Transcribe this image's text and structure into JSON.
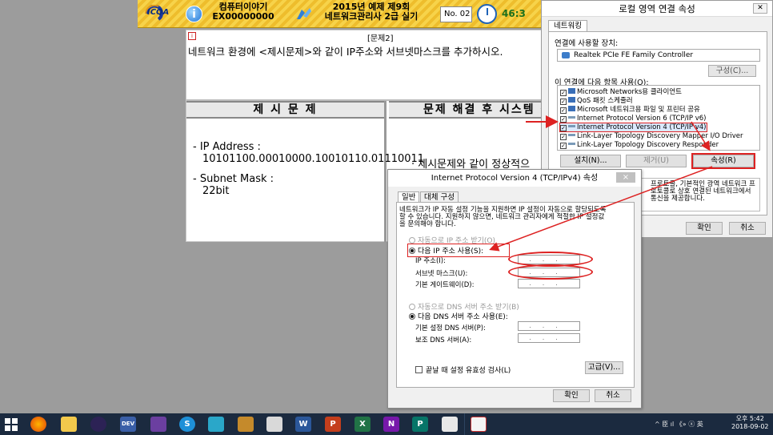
{
  "exam_header": {
    "logo_text": "ICQA",
    "info_icon": "i",
    "title_line1": "컴퓨터이야기",
    "title_line2": "EX00000000",
    "exam_line1": "2015년 예제 제9회",
    "exam_line2": "네트워크관리사 2급 실기",
    "question_no": "No. 02",
    "timer": "46:3"
  },
  "question": {
    "header": "[문제2]",
    "text": "네트워크 환경에 <제시문제>와 같이 IP주소와 서브넷마스크를 추가하시오.",
    "left_heading": "제 시 문 제",
    "right_heading": "문제 해결 후 시스템 상",
    "ip_label": "- IP Address :",
    "ip_value": "10101100.00010000.10010110.01110011",
    "mask_label": "- Subnet Mask :",
    "mask_value": "22bit",
    "after_text": "· 제시문제와 같이 정상적으"
  },
  "lan_dialog": {
    "title": "로컬 영역 연결 속성",
    "tab": "네트워킹",
    "connect_using_label": "연결에 사용할 장치:",
    "adapter": "Realtek PCIe FE Family Controller",
    "configure_button": "구성(C)...",
    "items_label": "이 연결에 다음 항목 사용(O):",
    "items": [
      "Microsoft Networks용 클라이언트",
      "QoS 패킷 스케줄러",
      "Microsoft 네트워크용 파일 및 프린터 공유",
      "Internet Protocol Version 6 (TCP/IP v6)",
      "Internet Protocol Version 4 (TCP/IP v4)",
      "Link-Layer Topology Discovery Mapper I/O Driver",
      "Link-Layer Topology Discovery Responder"
    ],
    "install_button": "설치(N)...",
    "uninstall_button": "제거(U)",
    "properties_button": "속성(R)",
    "description": "프로토콜, 기본적인 광역 네트워크 프로토콜로 상호 연결된 네트워크에서 통신을 제공합니다.",
    "ok_button": "확인",
    "cancel_button": "취소"
  },
  "ipv4_dialog": {
    "title": "Internet Protocol Version 4 (TCP/IPv4) 속성",
    "close": "×",
    "tab_general": "일반",
    "tab_alternate": "대체 구성",
    "description": "네트워크가 IP 자동 설정 기능을 지원하면 IP 설정이 자동으로 할당되도록 할 수 있습니다. 지원하지 않으면, 네트워크 관리자에게 적절한 IP 설정값을 문의해야 합니다.",
    "auto_ip": "자동으로 IP 주소 받기(O)",
    "manual_ip": "다음 IP 주소 사용(S):",
    "ip_address_label": "IP 주소(I):",
    "subnet_mask_label": "서브넷 마스크(U):",
    "gateway_label": "기본 게이트웨이(D):",
    "auto_dns": "자동으로 DNS 서버 주소 받기(B)",
    "manual_dns": "다음 DNS 서버 주소 사용(E):",
    "preferred_dns_label": "기본 설정 DNS 서버(P):",
    "alternate_dns_label": "보조 DNS 서버(A):",
    "ip_placeholder": "...",
    "validate_label": "끝날 때 설정 유효성 검사(L)",
    "advanced_button": "고급(V)...",
    "ok_button": "확인",
    "cancel_button": "취소"
  },
  "taskbar": {
    "icons": [
      "start",
      "firefox",
      "file-explorer",
      "eclipse",
      "dev-cpp",
      "visual-studio",
      "skype",
      "app",
      "paint",
      "network",
      "word",
      "powerpoint",
      "excel",
      "onenote",
      "publisher",
      "photoshop",
      "exam-app"
    ],
    "labels": {
      "dev": "DEV",
      "word": "W",
      "powerpoint": "P",
      "excel": "X",
      "onenote": "N",
      "publisher": "P",
      "skype": "S"
    },
    "tray_text": "^ 臣 ıl 《» ⓧ 英",
    "clock_time": "오후 5:42",
    "clock_date": "2018-09-02"
  },
  "colors": {
    "highlight_red": "#dd2222",
    "exam_header_yellow": "#f7d34a",
    "taskbar": "#1b2a3f",
    "desktop": "#9c9c9c"
  }
}
